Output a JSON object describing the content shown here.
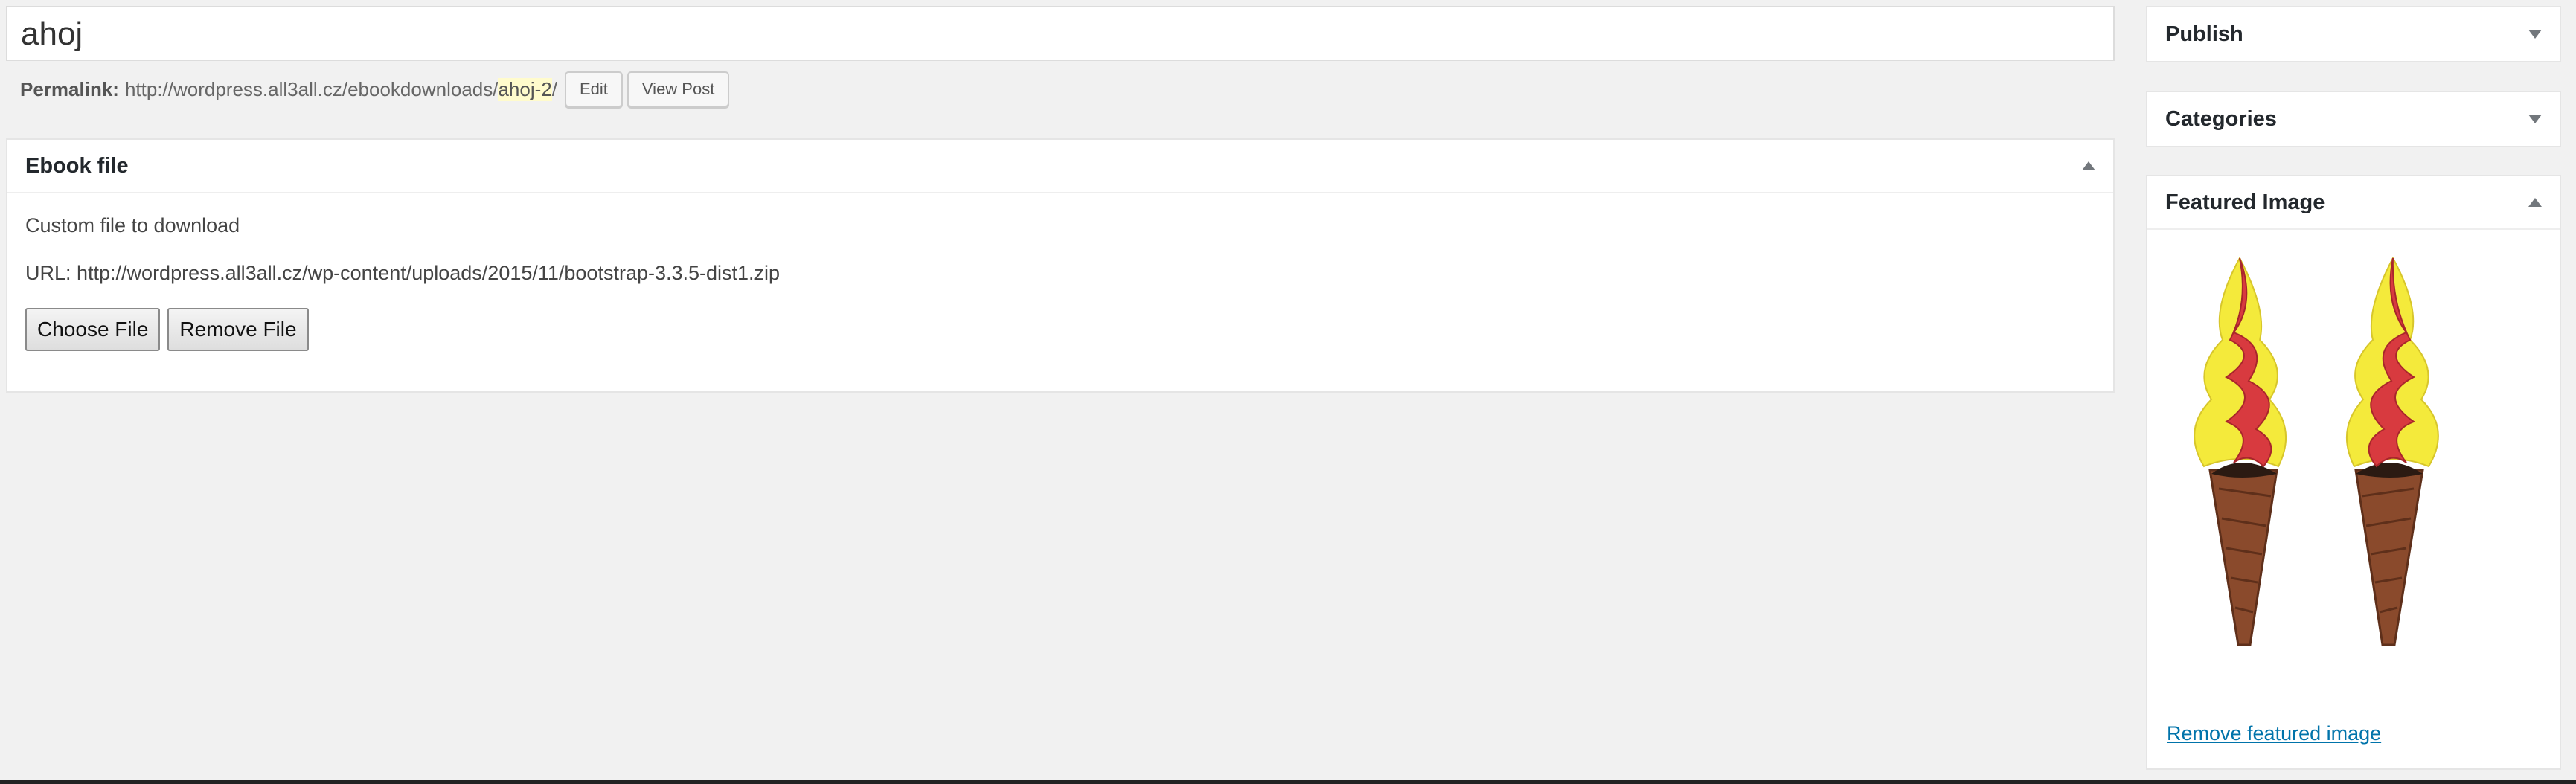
{
  "post": {
    "title": "ahoj"
  },
  "permalink": {
    "label": "Permalink:",
    "base_url": "http://wordpress.all3all.cz/ebookdownloads/",
    "slug": "ahoj-2",
    "trailing": "/",
    "edit_label": "Edit",
    "view_label": "View Post"
  },
  "ebook_box": {
    "title": "Ebook file",
    "description": "Custom file to download",
    "url_line": "URL: http://wordpress.all3all.cz/wp-content/uploads/2015/11/bootstrap-3.3.5-dist1.zip",
    "choose_label": "Choose File",
    "remove_label": "Remove File"
  },
  "sidebar": {
    "publish_title": "Publish",
    "categories_title": "Categories",
    "featured_title": "Featured Image",
    "remove_featured_label": "Remove featured image"
  },
  "colors": {
    "link": "#0073aa",
    "slug_highlight": "#fffbcc",
    "background": "#f1f1f1",
    "ice_cream_red": "#d83a3f",
    "ice_cream_yellow": "#f4ea3b",
    "cone_brown": "#8a4a2c"
  },
  "icons": {
    "collapse": "arrow-up-icon",
    "expand": "arrow-down-icon"
  }
}
